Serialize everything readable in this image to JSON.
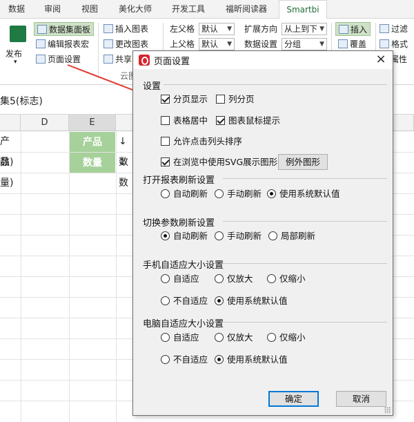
{
  "ribbon_tabs": [
    "数据",
    "审阅",
    "视图",
    "美化大师",
    "开发工具",
    "福昕阅读器",
    "Smartbi"
  ],
  "active_tab_index": 6,
  "ribbon": {
    "publish": "发布",
    "dataset_panel": "数据集面板",
    "edit_report_macro": "编辑报表宏",
    "page_setup": "页面设置",
    "insert_chart": "插入图表",
    "change_chart": "更改图表",
    "share": "共享",
    "cloud": "云图",
    "left_parent": "左父格",
    "top_parent": "上父格",
    "default_val": "默认",
    "expand_direction": "扩展方向",
    "top_to_bottom": "从上到下",
    "data_settings": "数据设置",
    "group": "分组",
    "insert": "插入",
    "overwrite": "覆盖",
    "filter": "过滤",
    "format": "格式",
    "attribute": "属性"
  },
  "namebar_text": "集5(标志)",
  "grid": {
    "col_d": "D",
    "col_e": "E",
    "left_cell_1": "产品)",
    "left_cell_2": "数量)",
    "green_1": "产品",
    "green_2": "数量",
    "arrow_cell_1": "↓数",
    "arrow_cell_2": "↓数"
  },
  "dialog": {
    "title": "页面设置",
    "close_glyph": "×",
    "sections": {
      "settings": "设置",
      "open_refresh": "打开报表刷新设置",
      "switch_refresh": "切换参数刷新设置",
      "mobile_fit": "手机自适应大小设置",
      "pc_fit": "电脑自适应大小设置"
    },
    "checkboxes": {
      "page_display": {
        "label": "分页显示",
        "checked": true
      },
      "column_page": {
        "label": "列分页",
        "checked": false
      },
      "table_center": {
        "label": "表格居中",
        "checked": false
      },
      "chart_tooltip": {
        "label": "图表鼠标提示",
        "checked": true
      },
      "header_sort": {
        "label": "允许点击列头排序",
        "checked": false
      },
      "svg_render": {
        "label": "在浏览中使用SVG展示图形",
        "checked": true
      }
    },
    "exception_chart_button": "例外图形",
    "open_refresh": {
      "auto": "自动刷新",
      "manual": "手动刷新",
      "system_default": "使用系统默认值",
      "selected": "system_default"
    },
    "switch_refresh": {
      "auto": "自动刷新",
      "manual": "手动刷新",
      "partial": "局部刷新",
      "selected": "auto"
    },
    "mobile_fit": {
      "adaptive": "自适应",
      "enlarge_only": "仅放大",
      "shrink_only": "仅缩小",
      "no_adaptive": "不自适应",
      "system_default": "使用系统默认值",
      "selected": "system_default"
    },
    "pc_fit": {
      "adaptive": "自适应",
      "enlarge_only": "仅放大",
      "shrink_only": "仅缩小",
      "no_adaptive": "不自适应",
      "system_default": "使用系统默认值",
      "selected": "system_default"
    },
    "ok": "确定",
    "cancel": "取消"
  },
  "colors": {
    "accent_green": "#a6d19a",
    "arrow_red": "#e03c31",
    "smartbi_green": "#1e6e3a"
  }
}
